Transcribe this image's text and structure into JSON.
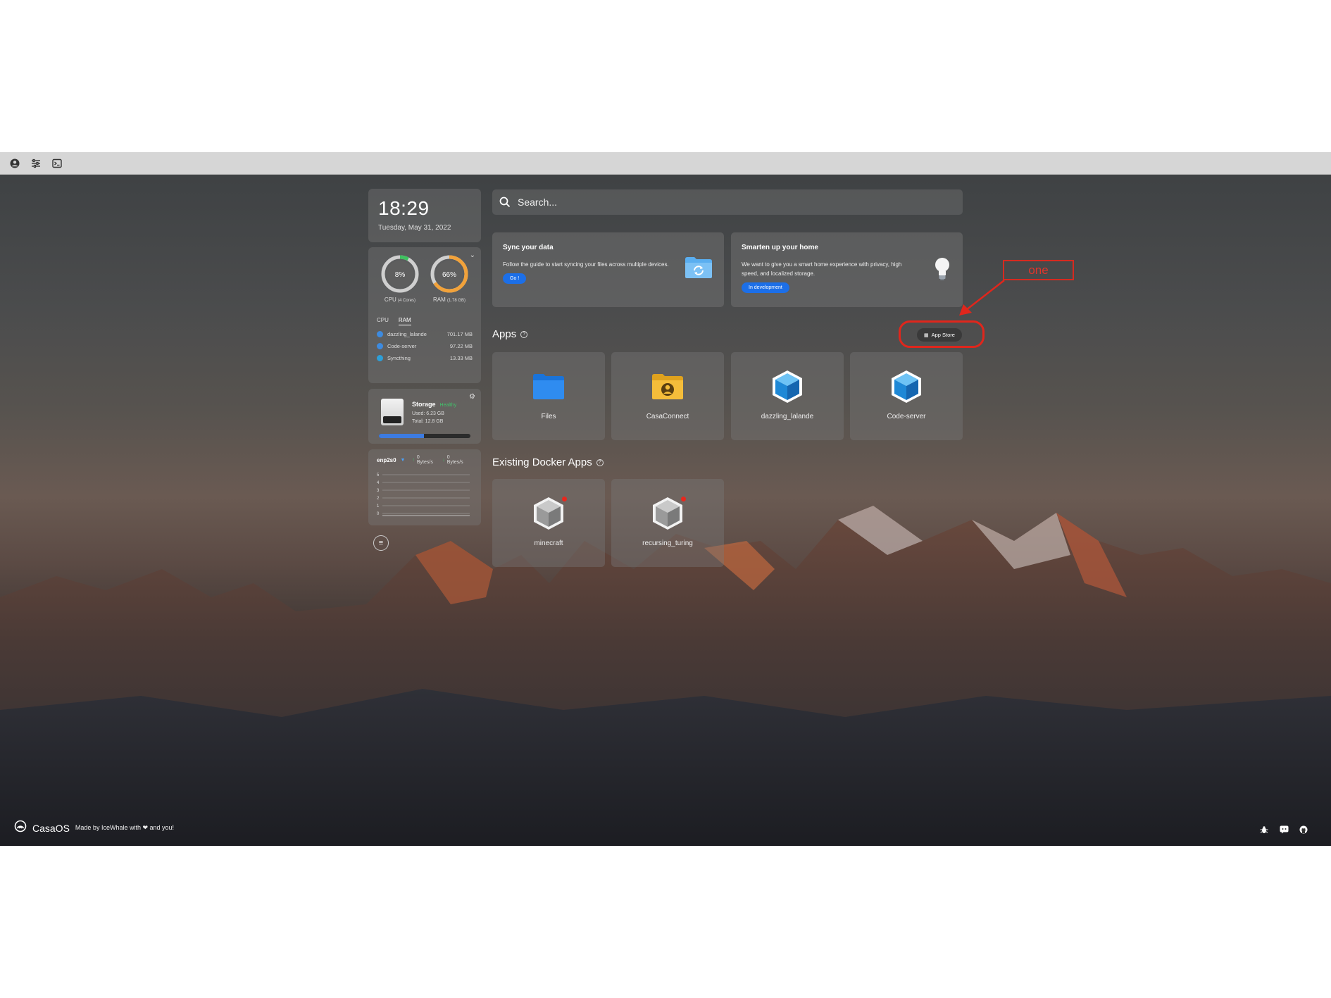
{
  "toolbar": {
    "icons": [
      "user-circle-icon",
      "sliders-icon",
      "terminal-icon"
    ]
  },
  "clock": {
    "time": "18:29",
    "date": "Tuesday, May 31, 2022"
  },
  "system": {
    "cpu": {
      "percent_label": "8%",
      "label": "CPU",
      "sub": "(4 Cores)",
      "fraction": 0.08,
      "color": "#3ec15f"
    },
    "ram": {
      "percent_label": "66%",
      "label": "RAM",
      "sub": "(1.78 GB)",
      "fraction": 0.66,
      "color": "#f2a23a"
    },
    "tabs": [
      "CPU",
      "RAM"
    ],
    "active_tab": "RAM",
    "processes": [
      {
        "name": "dazzling_lalande",
        "value": "701.17 MB"
      },
      {
        "name": "Code-server",
        "value": "97.22 MB"
      },
      {
        "name": "Syncthing",
        "value": "13.33 MB"
      }
    ]
  },
  "storage": {
    "title": "Storage",
    "health": "Healthy",
    "used": "Used: 6.23 GB",
    "total": "Total: 12.8 GB",
    "used_fraction": 0.49
  },
  "network": {
    "interface": "enp2s0",
    "up_rate": "0 Bytes/s",
    "down_rate": "0 Bytes/s",
    "y_ticks": [
      "5",
      "4",
      "3",
      "2",
      "1",
      "0"
    ]
  },
  "search": {
    "placeholder": "Search..."
  },
  "cards": [
    {
      "title": "Sync your data",
      "text": "Follow the guide to start syncing your files across multiple devices.",
      "button": "Go !"
    },
    {
      "title": "Smarten up your home",
      "text": "We want to give you a smart home experience with privacy, high speed, and localized storage.",
      "button": "In development"
    }
  ],
  "apps_section": {
    "title": "Apps",
    "app_store_label": "App Store",
    "annotation": "one",
    "apps": [
      {
        "name": "Files",
        "icon": "folder-blue-icon"
      },
      {
        "name": "CasaConnect",
        "icon": "folder-user-icon"
      },
      {
        "name": "dazzling_lalande",
        "icon": "cube-blue-icon"
      },
      {
        "name": "Code-server",
        "icon": "cube-blue-icon"
      }
    ]
  },
  "docker_section": {
    "title": "Existing Docker Apps",
    "apps": [
      {
        "name": "minecraft",
        "icon": "cube-gray-icon"
      },
      {
        "name": "recursing_turing",
        "icon": "cube-gray-icon"
      }
    ]
  },
  "footer": {
    "brand": "CasaOS",
    "made_by": "Made by IceWhale with ❤ and you!",
    "icons": [
      "bug-icon",
      "discord-icon",
      "github-icon"
    ]
  }
}
